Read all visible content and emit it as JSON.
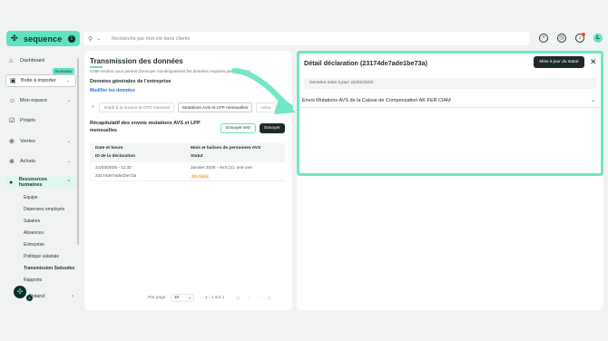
{
  "brand": {
    "name": "sequence",
    "badge": "Σ"
  },
  "search": {
    "placeholder": "Recherche par mot-clé dans clients"
  },
  "top_icons": [
    "add-circle-icon",
    "clock-icon",
    "bell-icon",
    "user-avatar"
  ],
  "user_initial": "L",
  "sidebar": {
    "new_badge": "Nouveau",
    "items": [
      {
        "label": "Dashboard",
        "icon": "home-icon"
      },
      {
        "label": "Boite à importer",
        "icon": "inbox-icon"
      },
      {
        "label": "Mon espace",
        "icon": "person-icon"
      },
      {
        "label": "Projets",
        "icon": "check-square-icon"
      },
      {
        "label": "Ventes",
        "icon": "sales-icon"
      },
      {
        "label": "Achats",
        "icon": "cart-icon"
      },
      {
        "label": "Ressources humaines",
        "icon": "people-icon"
      }
    ],
    "sub_items": [
      "Equipe",
      "Dépenses employés",
      "Salaires",
      "Absences",
      "Entreprise",
      "Politique salariale",
      "Transmission Swissdec",
      "Rapports"
    ],
    "user_name": "Roland",
    "floating_count": "1"
  },
  "main": {
    "title": "Transmission des données",
    "subtitle": "Cette section vous permet d'envoyer numériquement les données requises par Swissdec.",
    "section_title": "Données générales de l'entreprise",
    "edit_link": "Modifier les données",
    "tabs": [
      "Impôt à la source et CFS mensuel",
      "Mutations AVS et LPP mensuelles",
      "Annu"
    ],
    "recap_title": "Récapitulatif des envois mutations AVS et LPP mensuelles",
    "btn_test": "Envoyer test",
    "btn_send": "Envoyer",
    "table": {
      "col1_line1": "Date et heure",
      "col1_line2": "ID de la déclaration",
      "col2_line1": "Mois et balises de personnes AVS",
      "col2_line2": "Statut",
      "row": {
        "date": "21/03/2025 - 11:32",
        "id": "23174de7ade1be73a",
        "month": "Janvier 2025 - AVS (1): one one",
        "status": "En cours"
      }
    },
    "pager": {
      "per_page_label": "Par page:",
      "per_page_value": "10",
      "range": "1 - 1 sur 1"
    }
  },
  "detail": {
    "title": "Détail déclaration (23174de7ade1be73a)",
    "update_button": "Mise à jour du statut",
    "last_update": "Dernière mise à jour: 01/01/2025",
    "accordion_label": "Envoi Mutations AVS de la Caisse de Compensation AK FER CIAM"
  },
  "colors": {
    "accent": "#5fe3c2",
    "dark": "#1e2a2a",
    "link": "#2a6fdb",
    "highlight_frame": "#6fe7c8"
  }
}
